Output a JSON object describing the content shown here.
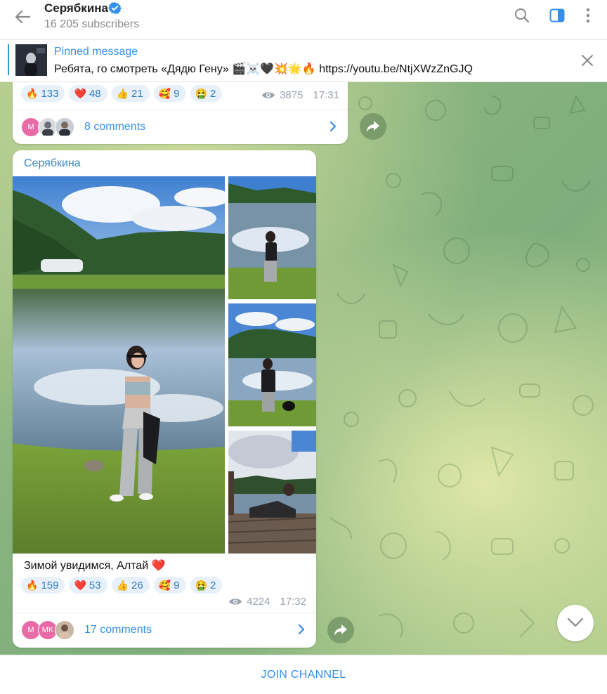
{
  "header": {
    "title": "Серябкина",
    "subscribers": "16 205 subscribers",
    "icons": [
      "back-arrow-icon",
      "verified-icon",
      "search-icon",
      "sidebar-toggle-icon",
      "more-vertical-icon"
    ],
    "accent_color": "#3390ec"
  },
  "pinned": {
    "label": "Pinned message",
    "text": "Ребята, го смотреть «Дядю Гену» 🎬☠️🖤💥🌟🔥  https://youtu.be/NtjXWzZnGJQ"
  },
  "messages": [
    {
      "reactions": [
        {
          "emoji": "🔥",
          "count": "133"
        },
        {
          "emoji": "❤️",
          "count": "48"
        },
        {
          "emoji": "👍",
          "count": "21"
        },
        {
          "emoji": "🥰",
          "count": "9"
        },
        {
          "emoji": "🤮",
          "count": "2"
        }
      ],
      "views": "3875",
      "time": "17:31",
      "comment_avatars": [
        "M"
      ],
      "comments": "8 comments"
    },
    {
      "author": "Серябкина",
      "text": "Зимой увидимся,  Алтай",
      "text_emoji": "❤️",
      "reactions": [
        {
          "emoji": "🔥",
          "count": "159"
        },
        {
          "emoji": "❤️",
          "count": "53"
        },
        {
          "emoji": "👍",
          "count": "26"
        },
        {
          "emoji": "🥰",
          "count": "9"
        },
        {
          "emoji": "🤮",
          "count": "2"
        }
      ],
      "views": "4224",
      "time": "17:32",
      "comment_avatars": [
        "M",
        "MK"
      ],
      "comments": "17 comments"
    }
  ],
  "footer": {
    "join_label": "JOIN CHANNEL"
  }
}
